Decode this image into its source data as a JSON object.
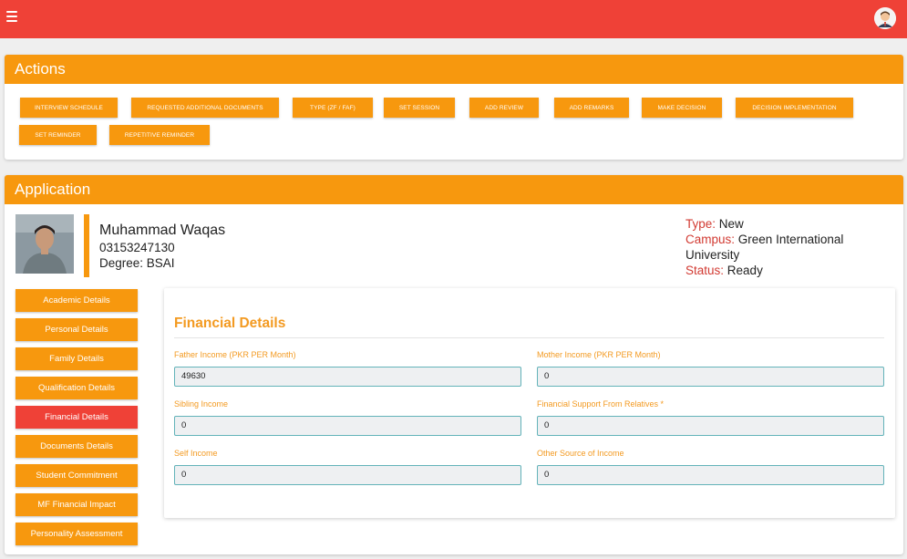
{
  "topbar": {
    "color": "#ef4137"
  },
  "actions": {
    "title": "Actions",
    "buttons": [
      "Interview Schedule",
      "Requested Additional Documents",
      "Type (ZF / FAF)",
      "Set Session",
      "Add Review",
      "Add Remarks",
      "Make Decision",
      "Decision Implementation",
      "Set Reminder",
      "Repetitive Reminder"
    ]
  },
  "application": {
    "title": "Application",
    "name": "Muhammad Waqas",
    "phone": "03153247130",
    "degree": "Degree: BSAI",
    "type_label": "Type:",
    "type_value": "New",
    "campus_label": "Campus:",
    "campus_value": "Green International University",
    "status_label": "Status:",
    "status_value": "Ready"
  },
  "sidebar": {
    "items": [
      "Academic Details",
      "Personal Details",
      "Family Details",
      "Qualification Details",
      "Financial Details",
      "Documents Details",
      "Student Commitment",
      "MF Financial Impact",
      "Personality Assessment"
    ],
    "active_item": "Financial Details"
  },
  "financial": {
    "title": "Financial Details",
    "fields": [
      {
        "label": "Father Income (PKR PER Month)",
        "value": "49630"
      },
      {
        "label": "Mother Income (PKR PER Month)",
        "value": "0"
      },
      {
        "label": "Sibling Income",
        "value": "0"
      },
      {
        "label": "Financial Support From Relatives *",
        "value": "0"
      },
      {
        "label": "Self Income",
        "value": "0"
      },
      {
        "label": "Other Source of Income",
        "value": "0"
      }
    ]
  },
  "colors": {
    "primary": "#f7980e",
    "danger": "#ef4137",
    "field_border": "#63b3b9"
  }
}
